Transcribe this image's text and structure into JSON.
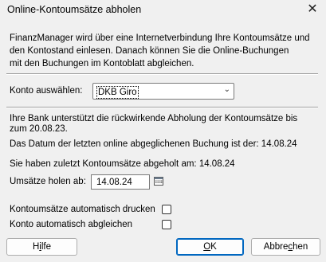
{
  "window": {
    "title": "Online-Kontoumsätze abholen"
  },
  "intro": {
    "line1": "FinanzManager wird über eine Internetverbindung Ihre Kontoumsätze und",
    "line2": "den Kontostand einlesen. Danach können Sie die Online-Buchungen",
    "line3": "mit den Buchungen im Kontoblatt abgleichen."
  },
  "account": {
    "label": "Konto auswählen:",
    "selected": "DKB Giro"
  },
  "info": {
    "line1": "Ihre Bank unterstützt die rückwirkende Abholung der Kontoumsätze bis",
    "line2": "zum 20.08.23.",
    "last_synced": "Das Datum der letzten online abgeglichenen Buchung ist der: 14.08.24",
    "last_fetched": "Sie haben zuletzt Kontoumsätze abgeholt am: 14.08.24"
  },
  "fetch_from": {
    "label": "Umsätze holen ab:",
    "value": "14.08.24"
  },
  "options": {
    "print_label": "Kontoumsätze automatisch drucken",
    "print_checked": false,
    "reconcile_label": "Konto automatisch abgleichen",
    "reconcile_checked": false
  },
  "buttons": {
    "help_pre": "H",
    "help_mn": "i",
    "help_post": "lfe",
    "ok_mn": "O",
    "ok_post": "K",
    "cancel_pre": "Abbre",
    "cancel_mn": "c",
    "cancel_post": "hen"
  }
}
